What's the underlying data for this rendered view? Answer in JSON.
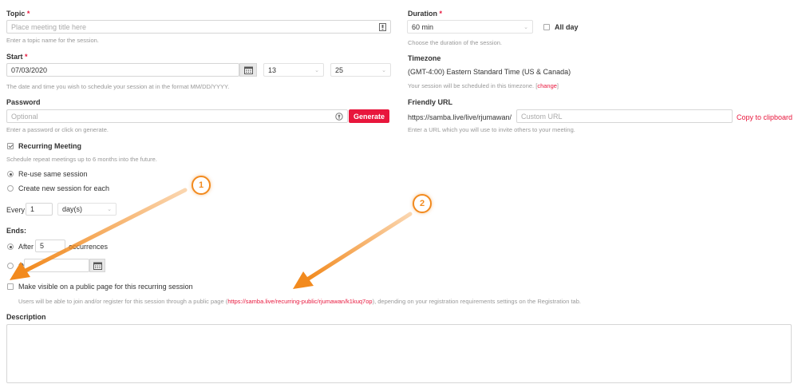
{
  "topic": {
    "label": "Topic",
    "required_mark": "*",
    "placeholder": "Place meeting title here",
    "hint": "Enter a topic name for the session."
  },
  "start": {
    "label": "Start",
    "required_mark": "*",
    "date_value": "07/03/2020",
    "hour_value": "13",
    "minute_value": "25",
    "hint": "The date and time you wish to schedule your session at in the format MM/DD/YYYY."
  },
  "password": {
    "label": "Password",
    "placeholder": "Optional",
    "generate_label": "Generate",
    "hint": "Enter a password or click on generate."
  },
  "recurring": {
    "label": "Recurring Meeting",
    "hint": "Schedule repeat meetings up to 6 months into the future.",
    "option_reuse": "Re-use same session",
    "option_new": "Create new session for each",
    "every_label": "Every",
    "every_value": "1",
    "unit_value": "day(s)",
    "ends_label": "Ends:",
    "after_label": "After",
    "after_value": "5",
    "occurrences_label": "occurrences",
    "on_label": "On",
    "public_label": "Make visible on a public page for this recurring session",
    "public_hint_pre": "Users will be able to join and/or register for this session through a public page (",
    "public_link": "https://samba.live/recurring-public/rjumawan/k1kuq7op",
    "public_hint_post": "), depending on your registration requirements settings on the Registration tab."
  },
  "duration": {
    "label": "Duration",
    "required_mark": "*",
    "value": "60 min",
    "all_day_label": "All day",
    "hint": "Choose the duration of the session."
  },
  "timezone": {
    "label": "Timezone",
    "value": "(GMT-4:00) Eastern Standard Time (US & Canada)",
    "hint_pre": "Your session will be scheduled in this timezone. [",
    "change_link": "change",
    "hint_post": "]"
  },
  "friendly_url": {
    "label": "Friendly URL",
    "prefix": "https://samba.live/live/rjumawan/",
    "placeholder": "Custom URL",
    "copy_label": "Copy to clipboard",
    "hint": "Enter a URL which you will use to invite others to your meeting."
  },
  "description": {
    "label": "Description"
  },
  "annotations": {
    "marker_1": "1",
    "marker_2": "2",
    "arrow_color": "#f28a1e"
  },
  "colors": {
    "accent": "#e8163c",
    "arrow": "#f28a1e"
  },
  "icons": {
    "topic_field": "text-format-icon",
    "date_picker": "calendar-icon",
    "password_field": "key-icon"
  }
}
